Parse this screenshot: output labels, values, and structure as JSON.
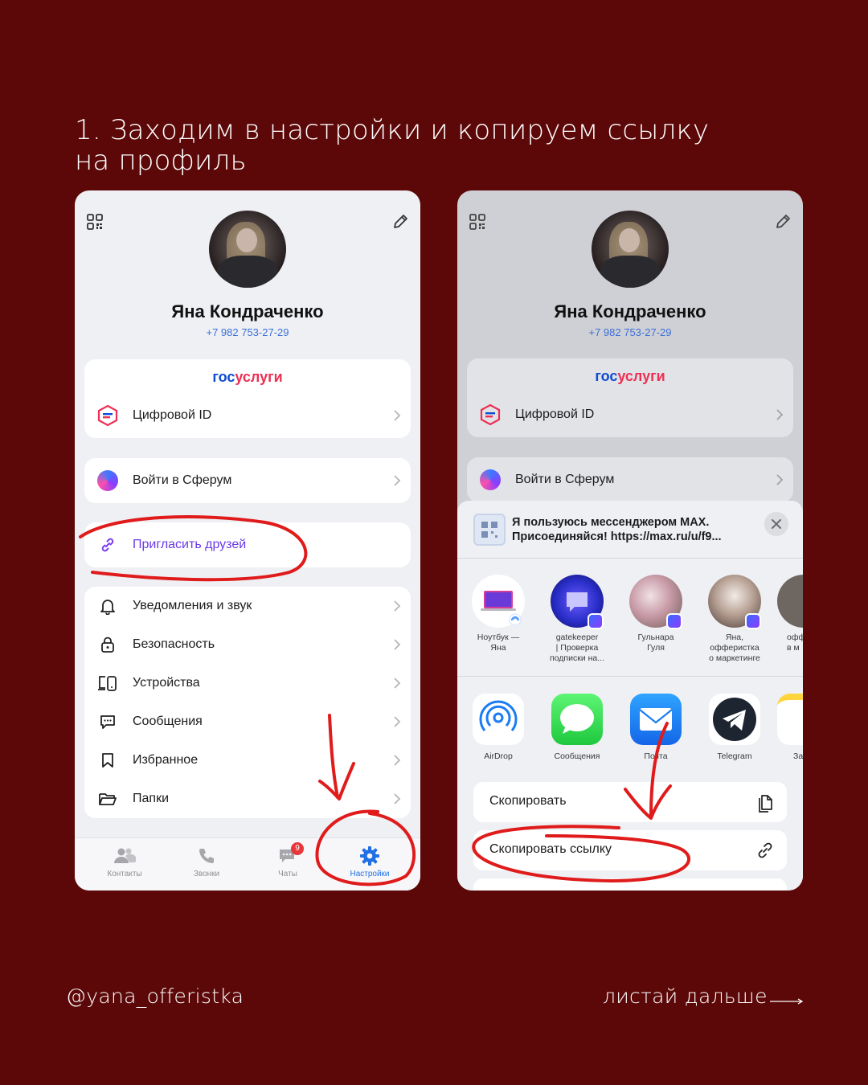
{
  "slide": {
    "title_line1": "1. Заходим в настройки и копируем ссылку",
    "title_line2": "на профиль",
    "footer_handle": "@yana_offeristka",
    "footer_next": "листай дальше"
  },
  "colors": {
    "background": "#5c0808",
    "accent": "#3c6fd8",
    "annotation": "#e01b1b"
  },
  "profile": {
    "name": "Яна Кондраченко",
    "phone": "+7 982 753-27-29"
  },
  "gosuslugi": {
    "part1": "гос",
    "part2": "услуги",
    "digital_id": "Цифровой ID"
  },
  "sferum": {
    "label": "Войти в Сферум"
  },
  "invite": {
    "label": "Пригласить друзей"
  },
  "settings": [
    {
      "label": "Уведомления и звук",
      "icon": "bell-icon"
    },
    {
      "label": "Безопасность",
      "icon": "lock-icon"
    },
    {
      "label": "Устройства",
      "icon": "devices-icon"
    },
    {
      "label": "Сообщения",
      "icon": "message-icon"
    },
    {
      "label": "Избранное",
      "icon": "bookmark-icon"
    },
    {
      "label": "Папки",
      "icon": "folder-icon"
    }
  ],
  "tabs": [
    {
      "label": "Контакты"
    },
    {
      "label": "Звонки"
    },
    {
      "label": "Чаты",
      "badge": "9"
    },
    {
      "label": "Настройки"
    }
  ],
  "share": {
    "message": "Я пользуюсь мессенджером MAX.",
    "message2": "Присоединяйся! https://max.ru/u/f9...",
    "contacts": [
      {
        "label": "Ноутбук —\nЯна"
      },
      {
        "label": "gatekeeper\n| Проверка\nподписки на..."
      },
      {
        "label": "Гульнара\nГуля"
      },
      {
        "label": "Яна,\nофферистка\nо маркетинге"
      },
      {
        "label": "офф\nв м"
      }
    ],
    "apps": [
      {
        "label": "AirDrop"
      },
      {
        "label": "Сообщения"
      },
      {
        "label": "Почта"
      },
      {
        "label": "Telegram"
      },
      {
        "label": "За"
      }
    ],
    "copy": "Скопировать",
    "copy_link": "Скопировать ссылку"
  }
}
